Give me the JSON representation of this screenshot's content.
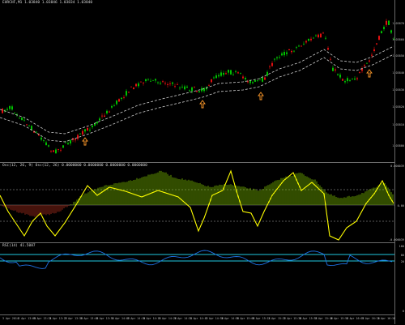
{
  "main_pane": {
    "title": "EURCHF,M1 1.03840 1.03846 1.03834 1.03840",
    "price_ticks": [
      "1.03870",
      "1.03860",
      "1.03850",
      "1.03840",
      "1.03830",
      "1.03820",
      "1.03810",
      "1.03800"
    ]
  },
  "osc_pane": {
    "title": "Osc(12, 26, 9) Osc(12, 26) 0.0000000 0.0000000 0.0000000 0.0000000",
    "ticks": [
      "0.000039",
      "0.00",
      "-0.000039"
    ]
  },
  "rsi_pane": {
    "title": "RSI(14) 41.5087",
    "ticks": [
      "100",
      "80",
      "20",
      "0"
    ]
  },
  "time_axis": {
    "labels": [
      "3 Apr 2014",
      "3 Apr 13:00",
      "3 Apr 13:14",
      "3 Apr 13:22",
      "3 Apr 13:38",
      "3 Apr 13:46",
      "3 Apr 13:54",
      "3 Apr 14:02",
      "3 Apr 14:10",
      "3 Apr 14:18",
      "3 Apr 14:26",
      "3 Apr 14:34",
      "3 Apr 14:42",
      "3 Apr 14:50",
      "3 Apr 14:58",
      "3 Apr 15:06",
      "3 Apr 15:14",
      "3 Apr 15:22",
      "3 Apr 15:30",
      "3 Apr 15:38",
      "3 Apr 15:46",
      "3 Apr 15:54",
      "3 Apr 16:02",
      "3 Apr 16:10",
      "3 Apr 16:18"
    ]
  },
  "colors": {
    "bull_candle": "#00c000",
    "bear_candle": "#e01010",
    "envelope": "#d0d0d0",
    "signal_arrow": "#ff9a2a",
    "osc_positive_hist": "#7cc000",
    "osc_negative_hist": "#b03020",
    "osc_line": "#ffff00",
    "osc_level": "#b0b0b0",
    "rsi_line": "#1e6fe0",
    "rsi_level": "#20c8e0"
  },
  "icons": [
    "up-arrow-signal-icon"
  ]
}
